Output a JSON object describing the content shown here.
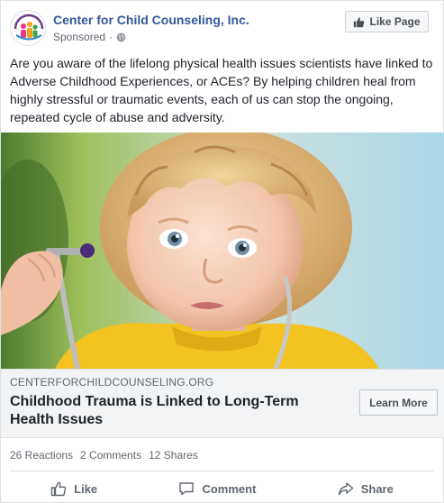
{
  "page": {
    "name": "Center for Child Counseling, Inc.",
    "sponsored": "Sponsored",
    "separator": "·",
    "avatar_icon": "child-counseling-logo",
    "like_page_label": "Like Page"
  },
  "post": {
    "text": "Are you aware of the lifelong physical health issues scientists have linked to Adverse Childhood Experiences, or ACEs? By helping children heal from highly stressful or traumatic events, each of us can stop the ongoing, repeated cycle of abuse and adversity."
  },
  "link": {
    "domain": "CENTERFORCHILDCOUNSELING.ORG",
    "headline": "Childhood Trauma is Linked to Long-Term Health Issues",
    "cta": "Learn More"
  },
  "stats": {
    "reactions": "26 Reactions",
    "comments": "2 Comments",
    "shares": "12 Shares"
  },
  "actions": {
    "like": "Like",
    "comment": "Comment",
    "share": "Share"
  },
  "colors": {
    "link_blue": "#365899",
    "text": "#1d2129",
    "muted": "#606770",
    "preview_bg": "#f2f3f5"
  }
}
